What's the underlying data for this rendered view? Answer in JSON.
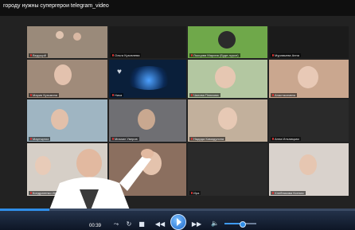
{
  "window": {
    "title": "городу нужны супергерои telegram_video"
  },
  "tiles": [
    {
      "name": "Ведущий",
      "bg": "#9a8a7a"
    },
    {
      "name": "Ольга Кузовлева",
      "bg": "#1b1b1b"
    },
    {
      "name": "Лысцова Марина (Буде-пурсе)",
      "bg": "#6fa84a"
    },
    {
      "name": "Муравьева Анна",
      "bg": "#1b1b1b"
    },
    {
      "name": "Мария Кузьмина",
      "bg": "#a08b7a"
    },
    {
      "name": "Ника",
      "bg": "#0a1f3a"
    },
    {
      "name": "Чалова Плюхова",
      "bg": "#b3c7a1"
    },
    {
      "name": "Анастасиявна",
      "bg": "#caa78f"
    },
    {
      "name": "Мартыргиз",
      "bg": "#9fb5c2"
    },
    {
      "name": "Михаил Уверов",
      "bg": "#6f6f73"
    },
    {
      "name": "Надида Камидулина",
      "bg": "#c2b09c"
    },
    {
      "name": "Анна Ильницкая",
      "bg": "#2a2a2a"
    },
    {
      "name": "Кондратенко Ира",
      "bg": "#d6cfc7"
    },
    {
      "name": "",
      "bg": "#8b6f5f"
    },
    {
      "name": "Ира",
      "bg": "#2a2a2a"
    },
    {
      "name": "Хлебникова Ксения",
      "bg": "#d9d2cc"
    }
  ],
  "player": {
    "current_time": "00:39",
    "progress": 0.14,
    "volume": 0.55,
    "controls": {
      "loop_icon": "loop-icon",
      "repeat_icon": "repeat-icon",
      "stop_icon": "stop-icon",
      "prev_icon": "rewind-icon",
      "play_icon": "play-icon",
      "next_icon": "fast-forward-icon",
      "volume_icon": "volume-icon"
    }
  }
}
